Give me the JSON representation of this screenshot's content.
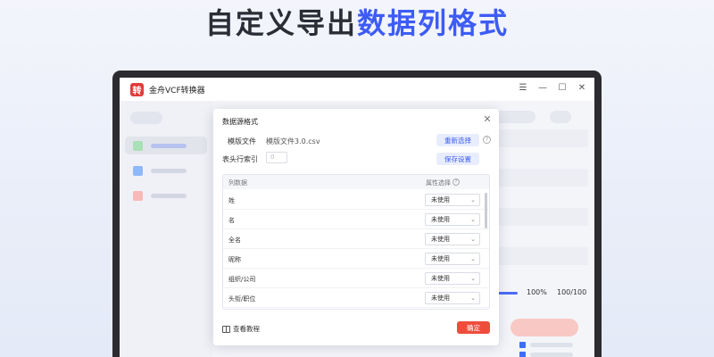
{
  "headline": {
    "part1": "自定义导出",
    "part2": "数据列格式"
  },
  "app": {
    "logo_char": "转",
    "title": "金舟VCF转换器"
  },
  "window_controls": {
    "menu": "☰",
    "minimize": "—",
    "maximize": "☐",
    "close": "✕"
  },
  "sidebar": {
    "items": [
      {
        "color": "#a8e0b8"
      },
      {
        "color": "#8fb8f8"
      },
      {
        "color": "#f8b8b8"
      }
    ]
  },
  "background": {
    "percent": "100%",
    "count": "100/100"
  },
  "dialog": {
    "title": "数据源格式",
    "close": "✕",
    "template_label": "模版文件",
    "template_value": "模版文件3.0.csv",
    "reselect_button": "重新选择",
    "help": "?",
    "header_index_label": "表头行索引",
    "header_index_value": "0",
    "save_button": "保存设置",
    "table": {
      "col1": "列数据",
      "col2": "属性选择",
      "rows": [
        {
          "name": "姓",
          "value": "未使用"
        },
        {
          "name": "名",
          "value": "未使用"
        },
        {
          "name": "全名",
          "value": "未使用"
        },
        {
          "name": "昵称",
          "value": "未使用"
        },
        {
          "name": "组织/公司",
          "value": "未使用"
        },
        {
          "name": "头衔/职位",
          "value": "未使用"
        }
      ]
    },
    "tutorial_link": "查看教程",
    "ok_button": "确定"
  }
}
